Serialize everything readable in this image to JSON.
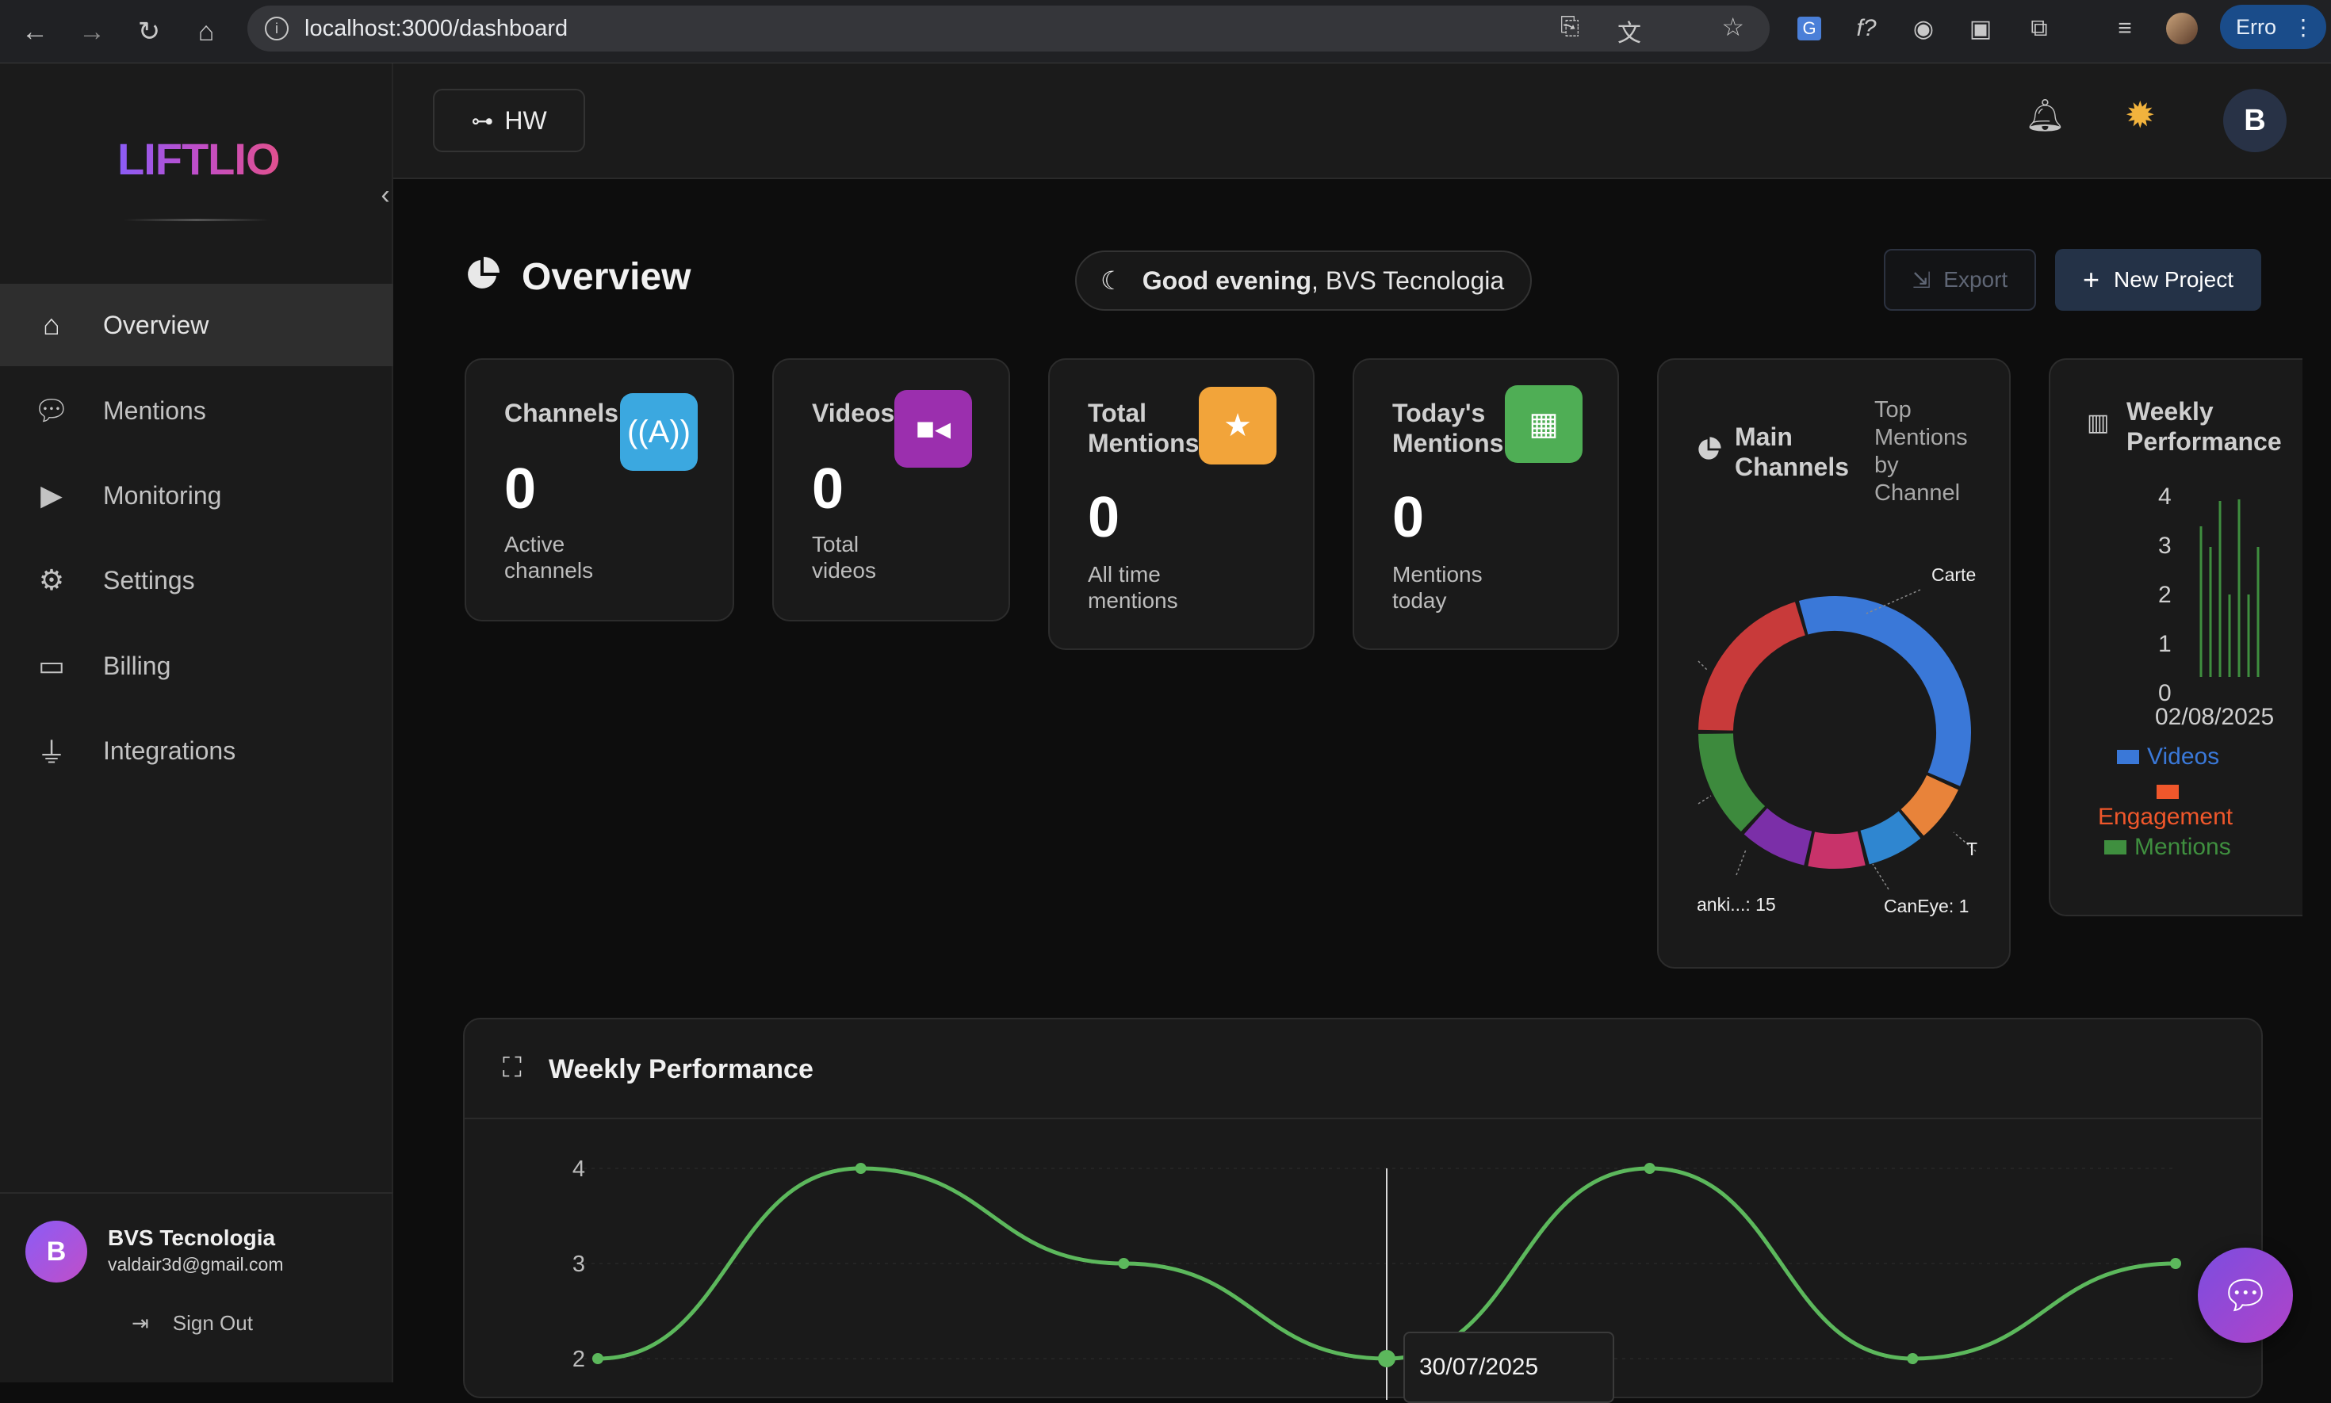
{
  "browser": {
    "url": "localhost:3000/dashboard",
    "profile_label": "Erro"
  },
  "sidebar": {
    "logo": "LIFTLIO",
    "items": [
      {
        "label": "Overview",
        "icon": "home-icon"
      },
      {
        "label": "Mentions",
        "icon": "comments-icon"
      },
      {
        "label": "Monitoring",
        "icon": "youtube-icon"
      },
      {
        "label": "Settings",
        "icon": "gear-icon"
      },
      {
        "label": "Billing",
        "icon": "credit-card-icon"
      },
      {
        "label": "Integrations",
        "icon": "plug-icon"
      }
    ],
    "user": {
      "initial": "B",
      "name": "BVS Tecnologia",
      "email": "valdair3d@gmail.com",
      "signout": "Sign Out"
    }
  },
  "topbar": {
    "project": "HW",
    "avatar_initial": "B"
  },
  "overview": {
    "title": "Overview",
    "greeting_bold": "Good evening",
    "greeting_name": ", BVS Tecnologia",
    "export": "Export",
    "new_project": "New Project"
  },
  "cards": [
    {
      "title": "Channels",
      "value": "0",
      "sub": "Active channels",
      "color": "#3ba8e0",
      "icon": "antenna-icon"
    },
    {
      "title": "Videos",
      "value": "0",
      "sub": "Total videos",
      "color": "#9b2fae",
      "icon": "video-camera-icon"
    },
    {
      "title": "Total Mentions",
      "value": "0",
      "sub": "All time mentions",
      "color": "#f2a43a",
      "icon": "star-icon"
    },
    {
      "title": "Today's Mentions",
      "value": "0",
      "sub": "Mentions today",
      "color": "#4fae55",
      "icon": "calendar-icon"
    }
  ],
  "main_channels": {
    "title": "Main Channels",
    "subtitle": "Top Mentions by Channel",
    "labels": {
      "top_right": "Carte",
      "bottom_left": "anki...: 15",
      "bottom_right": "CanEye: 1",
      "edge_right": "T"
    }
  },
  "weekly_mini": {
    "title": "Weekly Performance",
    "yticks": [
      "4",
      "3",
      "2",
      "1",
      "0"
    ],
    "xlabel": "02/08/2025",
    "legend": [
      {
        "name": "Videos",
        "color": "#3a78d8"
      },
      {
        "name": "Engagement",
        "color": "#f0572b"
      },
      {
        "name": "Mentions",
        "color": "#3f8f3f"
      }
    ]
  },
  "weekly_performance": {
    "title": "Weekly Performance",
    "yticks": [
      "4",
      "3",
      "2"
    ],
    "tooltip_date": "30/07/2025",
    "line_color": "#5cb85c"
  },
  "chart_data": [
    {
      "type": "pie",
      "title": "Main Channels",
      "subtitle": "Top Mentions by Channel",
      "slices": [
        {
          "label": "Carte",
          "color": "#3a78d8",
          "value": 30
        },
        {
          "label": "",
          "color": "#e8833a",
          "value": 6
        },
        {
          "label": "",
          "color": "#2f86d0",
          "value": 6
        },
        {
          "label": "CanEye: 1",
          "color": "#c8336a",
          "value": 6
        },
        {
          "label": "",
          "color": "#7b2fa8",
          "value": 7
        },
        {
          "label": "anki...: 15",
          "color": "#3d8a3d",
          "value": 11
        },
        {
          "label": "",
          "color": "#c83a3a",
          "value": 17
        }
      ]
    },
    {
      "type": "line",
      "title": "Weekly Performance",
      "x": [
        "",
        "",
        "",
        "30/07/2025",
        "",
        "",
        "",
        ""
      ],
      "series": [
        {
          "name": "",
          "values": [
            2,
            4,
            3,
            2,
            4,
            2,
            3
          ]
        }
      ],
      "ylim": [
        2,
        4
      ]
    }
  ]
}
